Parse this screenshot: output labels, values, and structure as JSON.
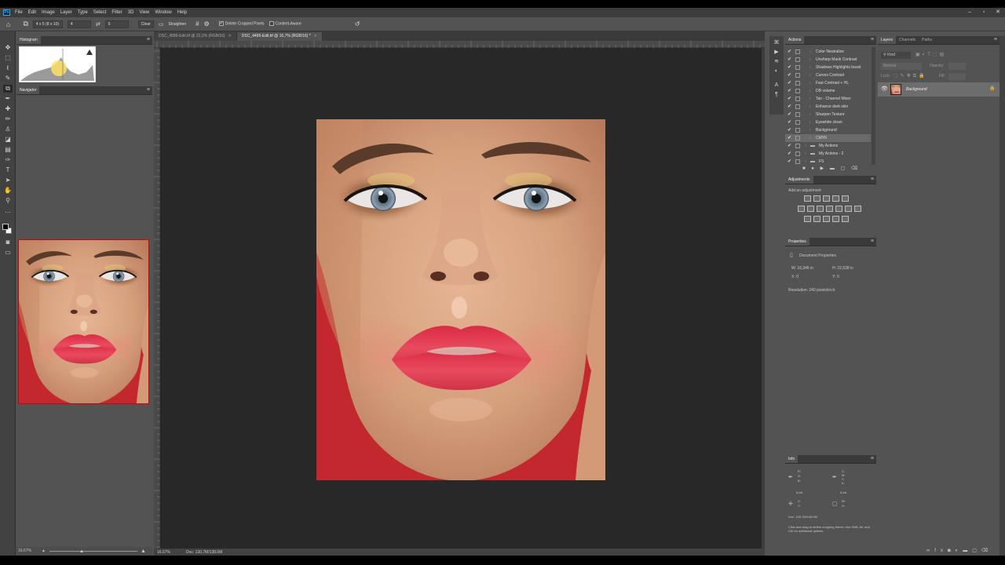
{
  "menu": [
    "File",
    "Edit",
    "Image",
    "Layer",
    "Type",
    "Select",
    "Filter",
    "3D",
    "View",
    "Window",
    "Help"
  ],
  "options": {
    "ratio": "4 x 5 (8 x 10)",
    "w": "4",
    "h": "5",
    "clear": "Clear",
    "straighten": "Straighten",
    "delete_cropped": "Delete Cropped Pixels",
    "content_aware": "Content-Aware"
  },
  "left_panels": {
    "histogram_tab": "Histogram",
    "navigator_tab": "Navigator",
    "zoom": "16.67%"
  },
  "doc_tabs": [
    {
      "label": "DSC_4589-Edit.tif @ 22,2% (RGB/16)"
    },
    {
      "label": "DSC_4495-Edit.tif @ 16,7% (RGB/16) *"
    }
  ],
  "status": {
    "zoom": "16.67%",
    "doc": "Doc: 130,7M/138.0M"
  },
  "actions": {
    "tab": "Actions",
    "items": [
      {
        "label": "Color Neutralize",
        "check": "✔"
      },
      {
        "label": "Unsharp Mask Contrast",
        "check": "✔"
      },
      {
        "label": "Shadows Highlights boost",
        "check": "✔"
      },
      {
        "label": "Curves Contrast",
        "check": "✔"
      },
      {
        "label": "Fast Contrast + HL",
        "check": "✔"
      },
      {
        "label": "DB volume",
        "check": "✔"
      },
      {
        "label": "Tan - Channel Mixer",
        "check": "✔"
      },
      {
        "label": "Enhance dark skin",
        "check": "✔"
      },
      {
        "label": "Sharpen Texture",
        "check": "✔"
      },
      {
        "label": "Eyewhite clean",
        "check": "✔"
      },
      {
        "label": "Background",
        "check": "✔"
      },
      {
        "label": "CMYK",
        "check": "✔"
      },
      {
        "label": "My Actions",
        "check": "✔"
      },
      {
        "label": "My Actions - 2",
        "check": "✔"
      },
      {
        "label": "FS",
        "check": "✔"
      }
    ]
  },
  "adjustments": {
    "tab": "Adjustments",
    "add": "Add an adjustment"
  },
  "properties": {
    "tab": "Properties",
    "doc_props": "Document Properties",
    "w": "W: 16,346 in",
    "h": "H: 22,538 in",
    "x": "X: 0",
    "y": "Y: 0",
    "resolution": "Resolution: 240 pixels/inch"
  },
  "info": {
    "tab": "Info",
    "r": "R:",
    "g": "G:",
    "b": "B:",
    "c": "C:",
    "m": "M:",
    "yk": "Y:",
    "k": "K:",
    "bit1": "8-bit",
    "bit2": "8-bit",
    "xl": "X:",
    "yl": "Y:",
    "wl": "W:",
    "hl": "H:",
    "doc": "Doc: 130,7M/138.0M",
    "hint": "Click and drag to define cropping frame. Use Shift, Alt, and Ctrl for additional options."
  },
  "layers": {
    "tabs": [
      "Layers",
      "Channels",
      "Paths"
    ],
    "kind": "Kind",
    "blend": "Normal",
    "opacity": "Opacity:",
    "lock": "Lock:",
    "fill": "Fill:",
    "layer_name": "Background"
  },
  "icons": {
    "lock": "lock-icon",
    "eye": "eye-icon"
  },
  "colors": {
    "lips": "#e23a4e",
    "backdrop": "#c3282e",
    "skin": "#d79f7b"
  }
}
